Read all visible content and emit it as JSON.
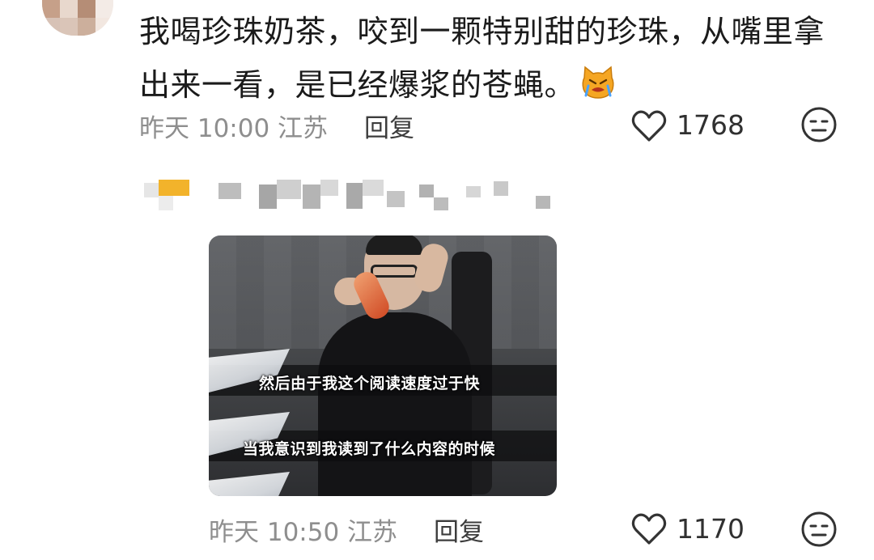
{
  "comment": {
    "text": "我喝珍珠奶茶，咬到一颗特别甜的珍珠，从嘴里拿出来一看，是已经爆浆的苍蝇。",
    "emoji": "crying-cat-emoji",
    "meta": "昨天 10:00 江苏",
    "reply_label": "回复",
    "like_count": "1768",
    "like_icon": "heart-outline-icon",
    "dislike_icon": "neutral-face-icon"
  },
  "reply_comment": {
    "video_subtitles": [
      "然后由于我这个阅读速度过于快",
      "当我意识到我读到了什么内容的时候"
    ],
    "meta": "昨天 10:50 江苏",
    "reply_label": "回复",
    "like_count": "1170",
    "like_icon": "heart-outline-icon",
    "dislike_icon": "neutral-face-icon"
  },
  "colors": {
    "meta_gray": "#8e8e8e",
    "text": "#1b1b1b",
    "blur_orange": "#f2b32b"
  }
}
